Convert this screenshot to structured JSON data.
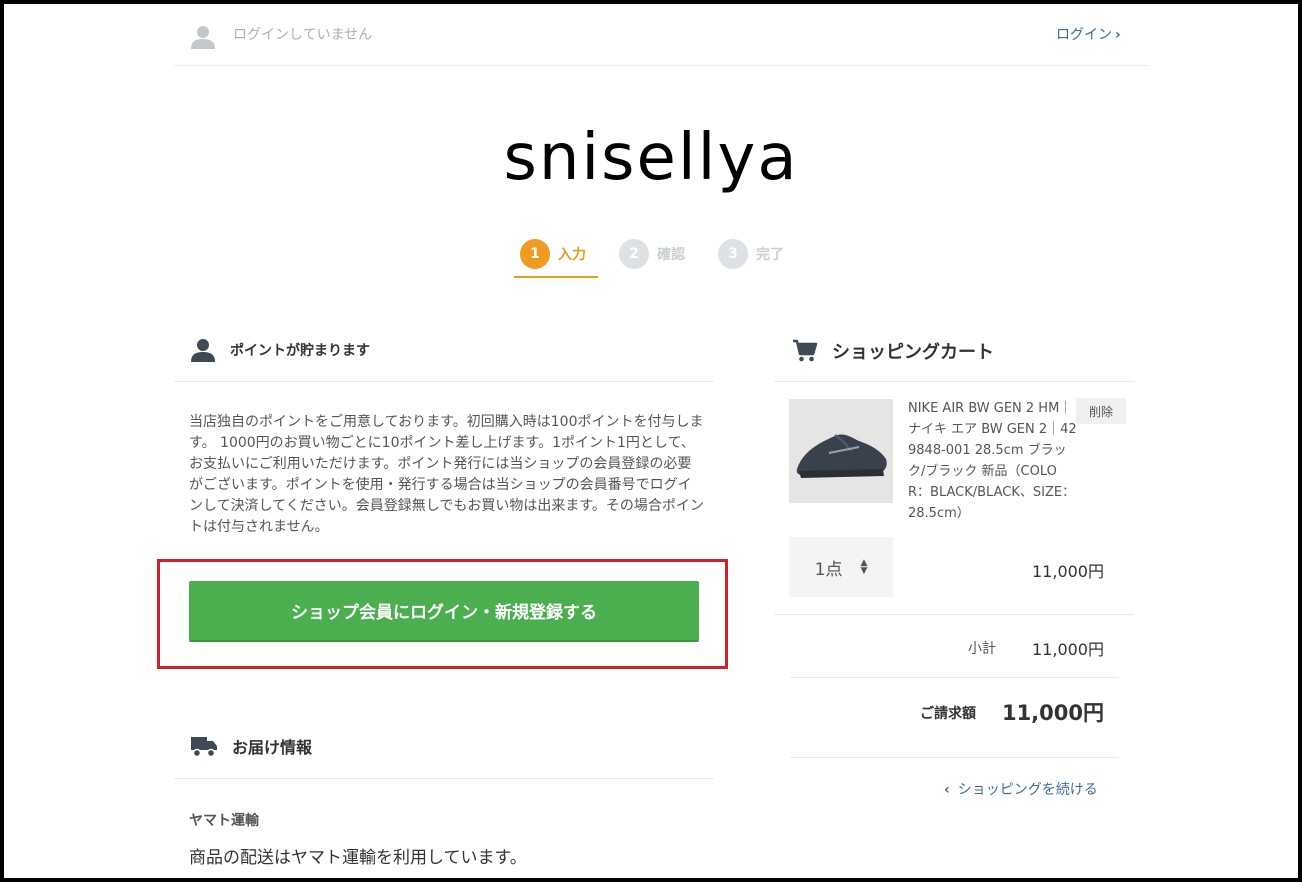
{
  "header": {
    "login_status": "ログインしていません",
    "login_link": "ログイン",
    "shop_name": "snisellya"
  },
  "steps": [
    {
      "num": "1",
      "label": "入力"
    },
    {
      "num": "2",
      "label": "確認"
    },
    {
      "num": "3",
      "label": "完了"
    }
  ],
  "points": {
    "title": "ポイントが貯まります",
    "text": "当店独自のポイントをご用意しております。初回購入時は100ポイントを付与します。 1000円のお買い物ごとに10ポイント差し上げます。1ポイント1円として、 お支払いにご利用いただけます。ポイント発行には当ショップの会員登録の必要がございます。ポイントを使用・発行する場合は当ショップの会員番号でログインして決済してください。会員登録無しでもお買い物は出来ます。その場合ポイントは付与されません。",
    "button": "ショップ会員にログイン・新規登録する"
  },
  "delivery": {
    "title": "お届け情報",
    "carrier": "ヤマト運輸",
    "text": "商品の配送はヤマト運輸を利用しています。"
  },
  "cart": {
    "title": "ショッピングカート",
    "item": {
      "name": "NIKE AIR BW GEN 2 HM｜ナイキ エア BW GEN 2｜429848-001 28.5cm ブラック/ブラック 新品（COLOR：BLACK/BLACK、SIZE：28.5cm）",
      "delete": "削除",
      "qty": "1点",
      "price": "11,000円"
    },
    "subtotal_label": "小計",
    "subtotal": "11,000円",
    "total_label": "ご請求額",
    "total": "11,000円",
    "continue": "ショッピングを続ける"
  },
  "colors": {
    "accent_orange": "#ef9b21",
    "button_green": "#4bae4f",
    "highlight_red": "#d0202a",
    "link_blue": "#3d6b9c"
  }
}
